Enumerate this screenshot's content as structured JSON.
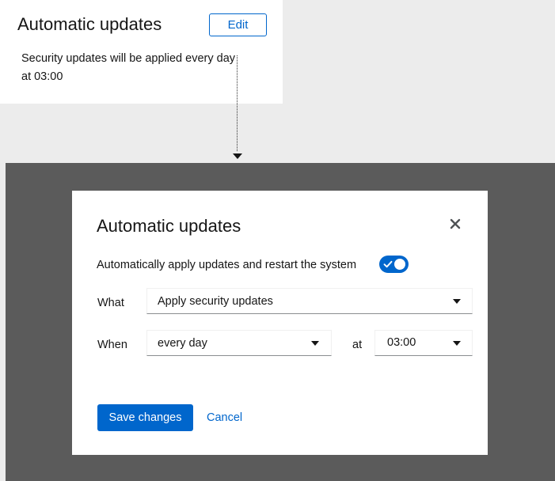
{
  "card": {
    "title": "Automatic updates",
    "edit_label": "Edit",
    "description": "Security updates will be applied every day at 03:00"
  },
  "modal": {
    "title": "Automatic updates",
    "close_icon": "close-icon",
    "toggle": {
      "label": "Automatically apply updates and restart the system",
      "checked": true
    },
    "what": {
      "label": "What",
      "value": "Apply security updates"
    },
    "when": {
      "label": "When",
      "value": "every day",
      "at_label": "at",
      "time": "03:00"
    },
    "save_label": "Save changes",
    "cancel_label": "Cancel"
  },
  "colors": {
    "accent": "#0066cc",
    "backdrop": "#5b5b5b",
    "page_bg": "#ececec"
  }
}
